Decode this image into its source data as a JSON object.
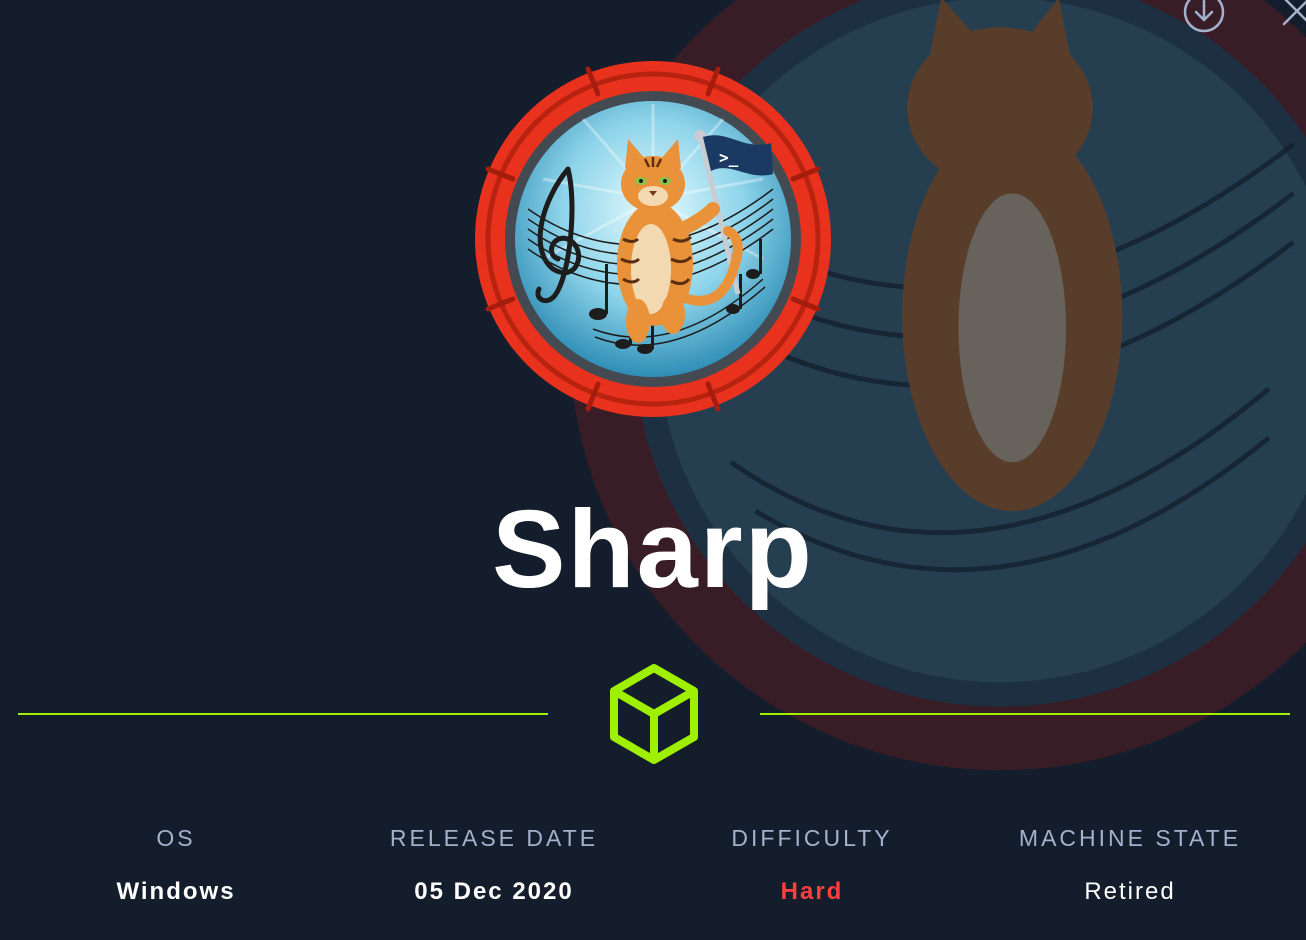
{
  "machine": {
    "name": "Sharp"
  },
  "toolbar": {
    "download_icon": "download-circle-icon",
    "close_icon": "close-icon"
  },
  "info": {
    "os": {
      "label": "OS",
      "value": "Windows"
    },
    "release": {
      "label": "RELEASE DATE",
      "value": "05 Dec 2020"
    },
    "difficulty": {
      "label": "DIFFICULTY",
      "value": "Hard"
    },
    "state": {
      "label": "MACHINE STATE",
      "value": "Retired"
    }
  },
  "avatar": {
    "flag_text": ">_"
  },
  "colors": {
    "background": "#141d2b",
    "accent_green": "#9fef00",
    "difficulty_red": "#ff3e3e",
    "ring_red": "#e8321e",
    "label_grey": "#a4b1cd"
  }
}
